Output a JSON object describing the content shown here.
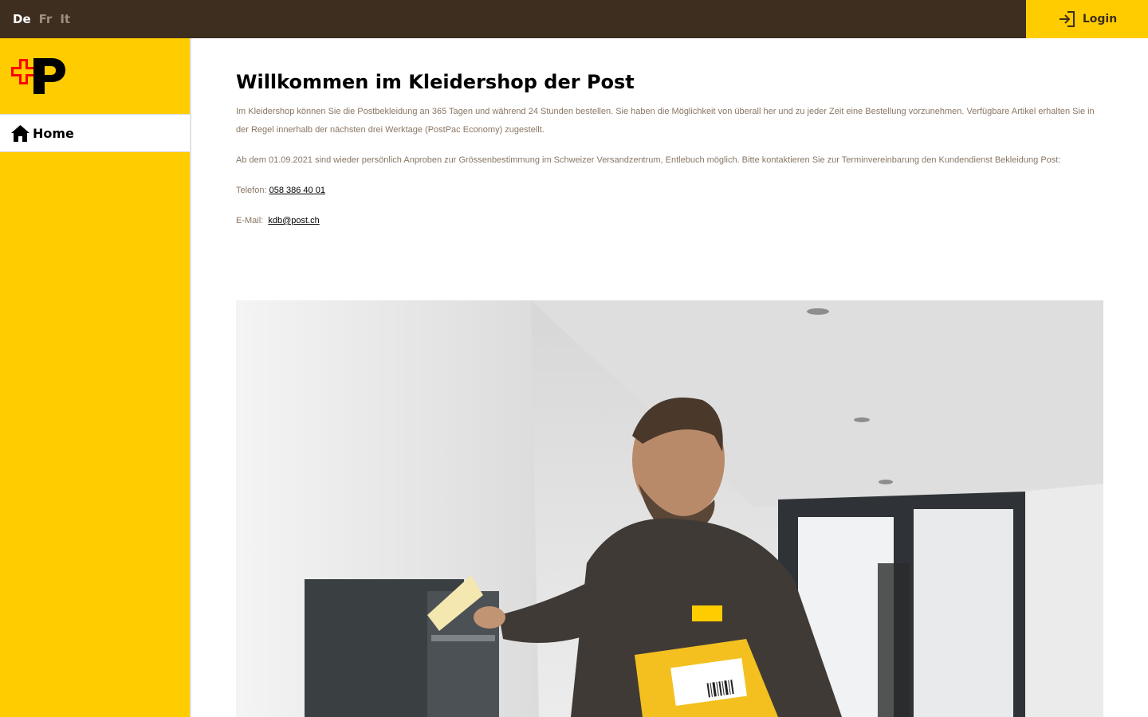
{
  "header": {
    "languages": [
      {
        "label": "De",
        "active": true
      },
      {
        "label": "Fr",
        "active": false
      },
      {
        "label": "It",
        "active": false
      }
    ],
    "login_label": "Login",
    "login_icon": "login-icon"
  },
  "sidebar": {
    "logo": "swiss-post-logo",
    "nav": [
      {
        "label": "Home",
        "icon": "home-icon",
        "active": true
      }
    ]
  },
  "main": {
    "title": "Willkommen im Kleidershop der Post",
    "intro": "Im Kleidershop können Sie die Postbekleidung an 365 Tagen und während 24 Stunden bestellen. Sie haben die Möglichkeit von überall her und zu jeder Zeit eine Bestellung vorzunehmen. Verfügbare Artikel erhalten Sie in der Regel innerhalb der nächsten drei Werktage (PostPac Economy) zugestellt.",
    "fitting_note": "Ab dem 01.09.2021 sind wieder persönlich Anproben zur Grössenbestimmung im Schweizer Versandzentrum, Entlebuch möglich. Bitte kontaktieren Sie zur Terminvereinbarung den Kundendienst Bekleidung Post:",
    "phone_label": "Telefon:",
    "phone_value": "058 386 40 01",
    "email_label": "E-Mail:",
    "email_value": "kdb@post.ch",
    "hero_image_alt": "Postbote mit Paket am Briefkasten"
  },
  "colors": {
    "header_bg": "#3d2e1f",
    "brand_yellow": "#ffcc00",
    "brand_red": "#ff0000",
    "text_muted": "#8a7664"
  }
}
